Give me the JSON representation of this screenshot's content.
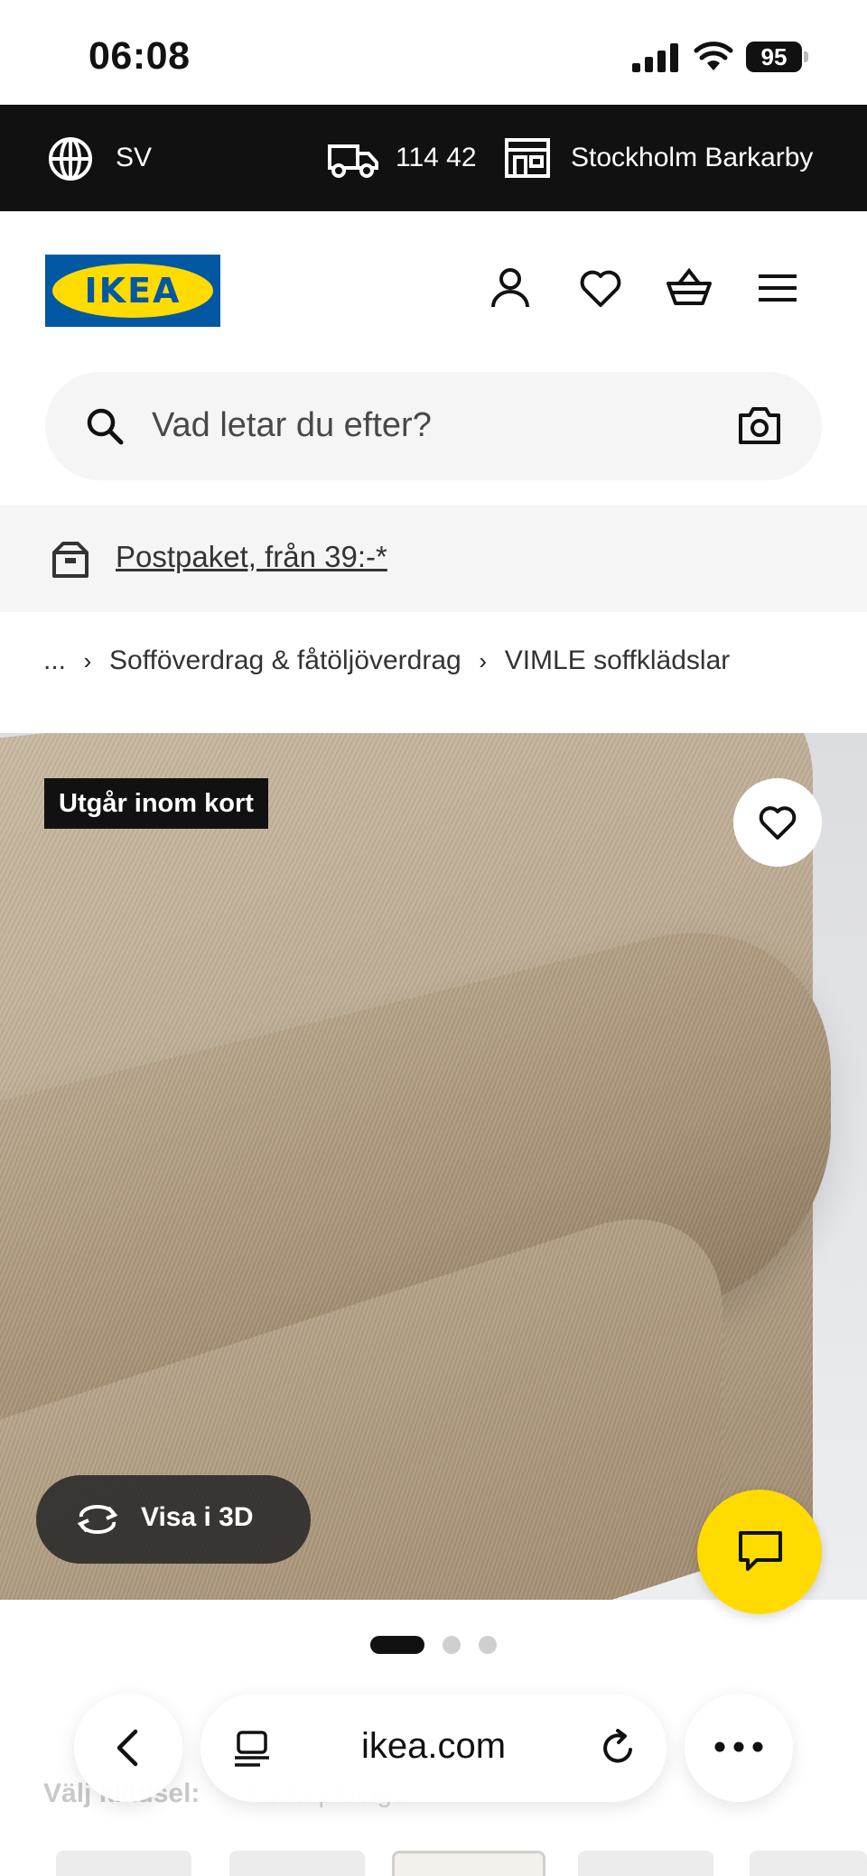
{
  "status_bar": {
    "time": "06:08",
    "battery": "95"
  },
  "topbar": {
    "language": "SV",
    "zip": "114 42",
    "store": "Stockholm Barkarby"
  },
  "header": {
    "logo_text": "IKEA"
  },
  "search": {
    "placeholder": "Vad letar du efter?"
  },
  "banner": {
    "text": "Postpaket, från 39:-*"
  },
  "breadcrumb": {
    "ellipsis": "...",
    "items": [
      "Sofföverdrag & fåtöljöverdrag",
      "VIMLE soffklädslar"
    ]
  },
  "product": {
    "badge": "Utgår inom kort",
    "view_3d_label": "Visa i 3D",
    "image_index": 1,
    "image_count": 3
  },
  "below": {
    "label": "Välj klädsel:",
    "value": "Hallarp beige"
  },
  "browser": {
    "url": "ikea.com"
  },
  "colors": {
    "ikea_blue": "#0058A3",
    "ikea_yellow": "#FFDB00",
    "topbar_bg": "#111111"
  },
  "icons": [
    "globe-icon",
    "truck-icon",
    "store-icon",
    "user-icon",
    "heart-icon",
    "cart-icon",
    "menu-icon",
    "search-icon",
    "camera-icon",
    "parcel-icon",
    "rotate-3d-icon",
    "chat-icon",
    "back-icon",
    "tabs-icon",
    "reload-icon",
    "more-icon"
  ]
}
